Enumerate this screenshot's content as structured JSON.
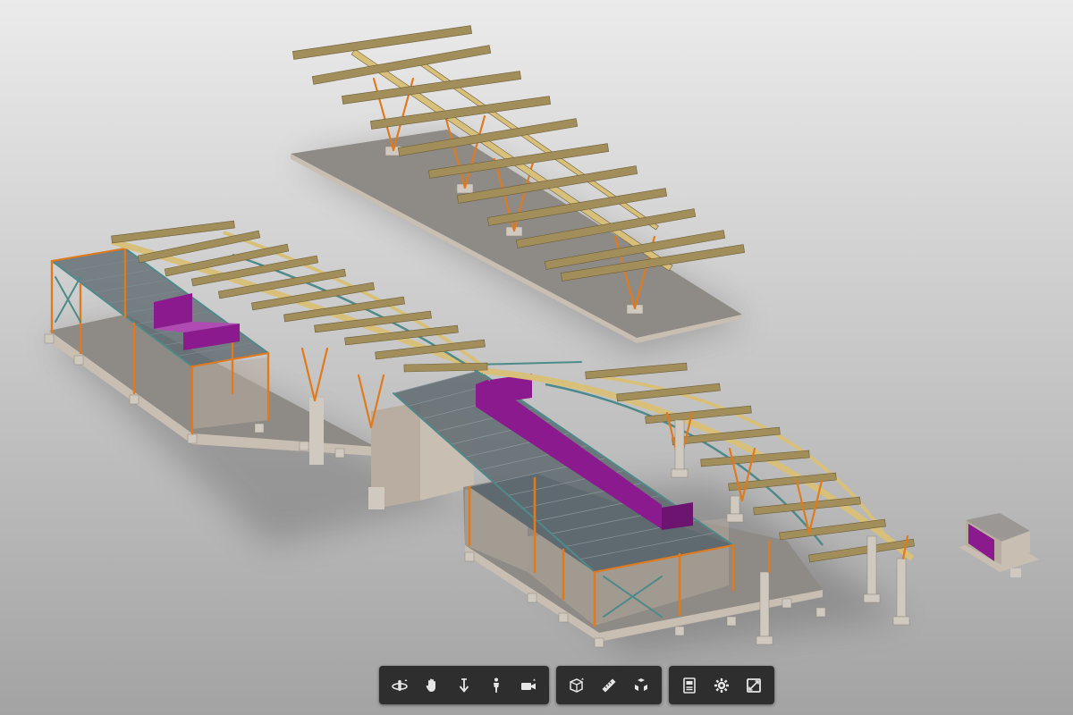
{
  "viewer": {
    "colors": {
      "background_top": "#ebebeb",
      "background_bottom": "#a3a3a3",
      "beam": "#a18e5a",
      "arch": "#d9c07a",
      "column": "#e07a1c",
      "bracing": "#4f8a8a",
      "slab_top": "#8e8a86",
      "slab_side": "#c8bfb2",
      "wall": "#b8ada0",
      "footing": "#cfc9c0",
      "duct": "#8b1a8e",
      "deck": "#5f6a70",
      "toolbar_bg": "#2e2e2e",
      "icon": "#e6e6e6"
    }
  },
  "toolbar": {
    "groups": [
      {
        "name": "navigation",
        "buttons": [
          "orbit-icon",
          "pan-icon",
          "dolly-icon",
          "first-person-icon",
          "camera-icon"
        ]
      },
      {
        "name": "tools",
        "buttons": [
          "section-box-icon",
          "measure-icon",
          "explode-icon"
        ]
      },
      {
        "name": "settings",
        "buttons": [
          "model-browser-icon",
          "settings-icon",
          "fullscreen-icon"
        ]
      }
    ]
  }
}
